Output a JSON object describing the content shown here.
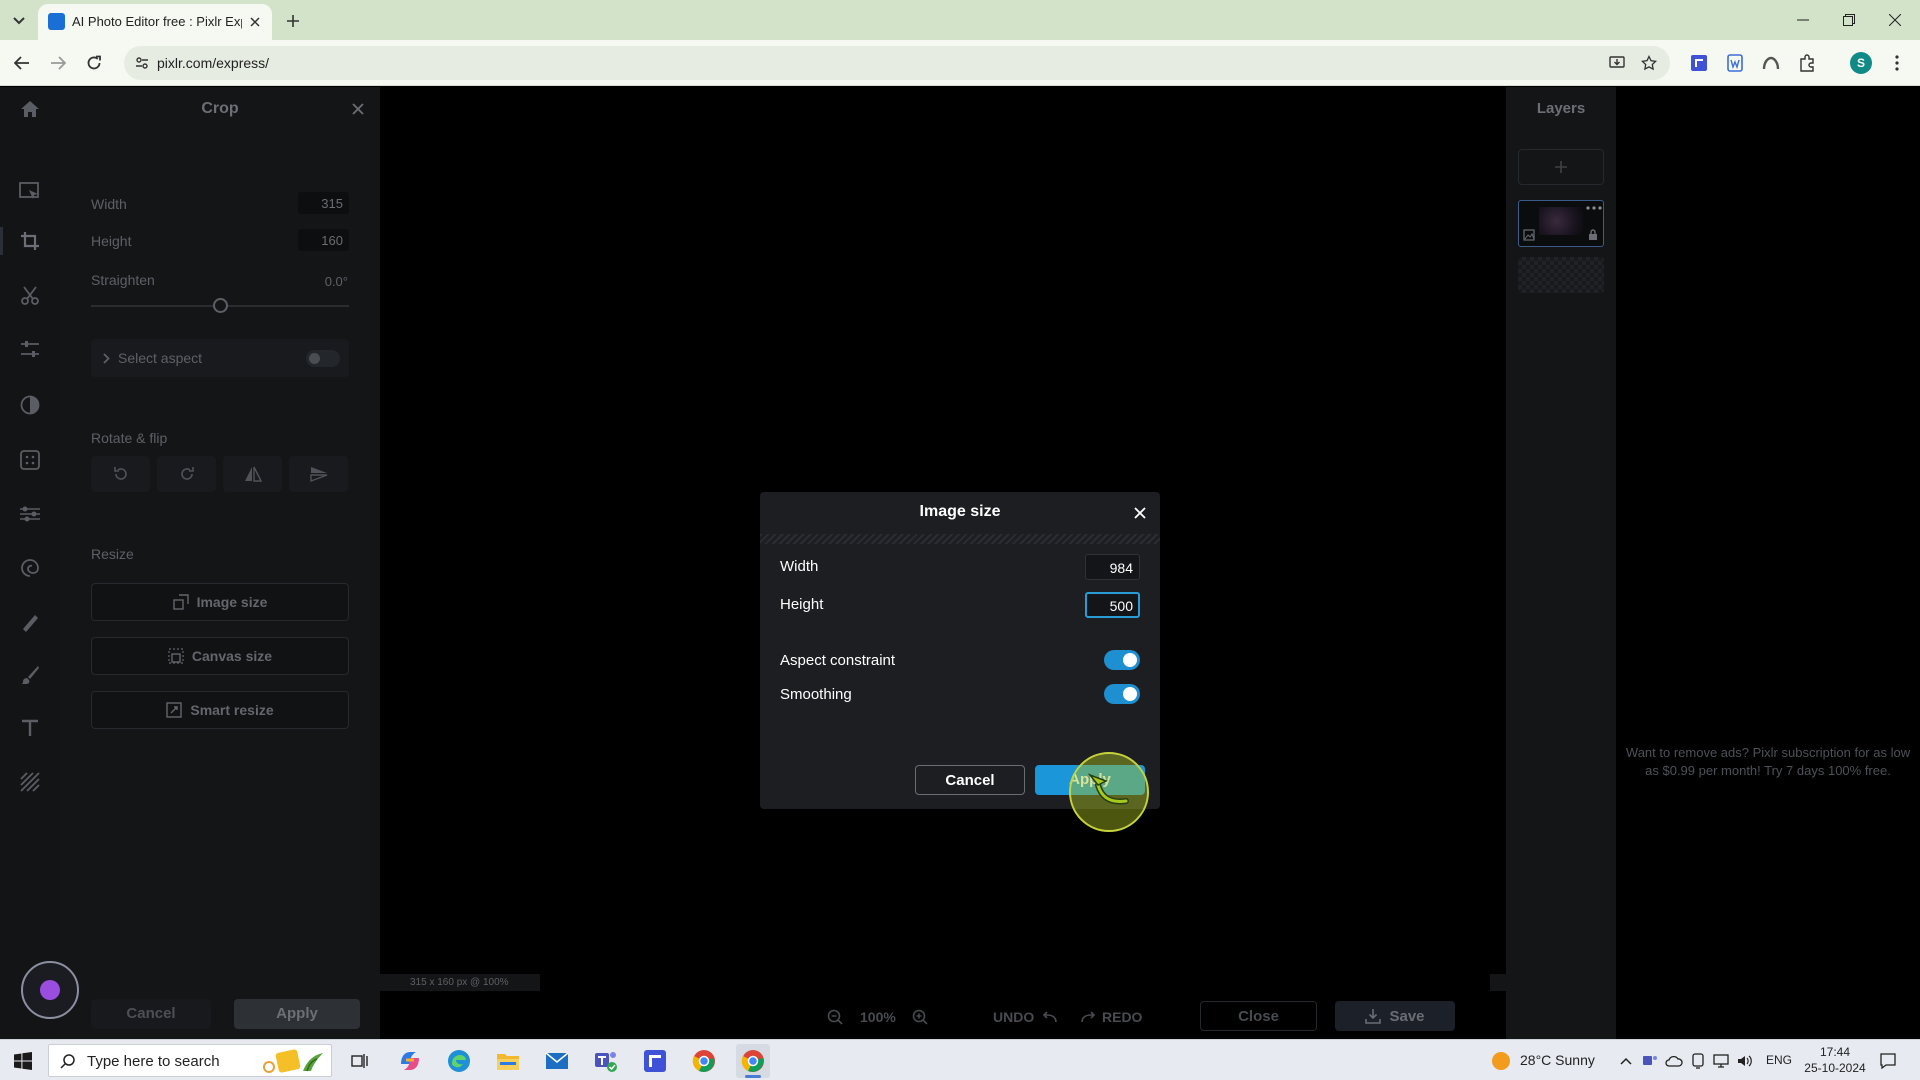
{
  "browser": {
    "tab_title": "AI Photo Editor free : Pixlr Express",
    "url": "pixlr.com/express/",
    "profile_initial": "S"
  },
  "crop_panel": {
    "title": "Crop",
    "width_label": "Width",
    "width_value": "315",
    "height_label": "Height",
    "height_value": "160",
    "straighten_label": "Straighten",
    "straighten_value": "0.0°",
    "straighten_level": 0.5,
    "select_aspect_label": "Select aspect",
    "select_aspect_on": false,
    "rotate_flip_label": "Rotate & flip",
    "resize_label": "Resize",
    "image_size_label": "Image size",
    "canvas_size_label": "Canvas size",
    "smart_resize_label": "Smart resize",
    "cancel_label": "Cancel",
    "apply_label": "Apply"
  },
  "canvas": {
    "status": "315 x 160 px @ 100%"
  },
  "bottom_bar": {
    "zoom": "100%",
    "undo_label": "UNDO",
    "redo_label": "REDO",
    "close_label": "Close",
    "save_label": "Save"
  },
  "layers": {
    "title": "Layers"
  },
  "ad": {
    "text": "Want to remove ads? Pixlr subscription for as low as $0.99 per month! Try 7 days 100% free."
  },
  "modal": {
    "title": "Image size",
    "width_label": "Width",
    "width_value": "984",
    "height_label": "Height",
    "height_value": "500",
    "aspect_label": "Aspect constraint",
    "aspect_on": true,
    "smoothing_label": "Smoothing",
    "smoothing_on": true,
    "cancel_label": "Cancel",
    "apply_label": "Apply"
  },
  "taskbar": {
    "search_placeholder": "Type here to search",
    "weather": "28°C  Sunny",
    "language": "ENG",
    "time": "17:44",
    "date": "25-10-2024"
  },
  "colors": {
    "accent": "#1a96d9",
    "modal_bg": "#1c1e22",
    "panel_bg": "#141517",
    "chrome_tabbar": "#d3e3c9"
  }
}
